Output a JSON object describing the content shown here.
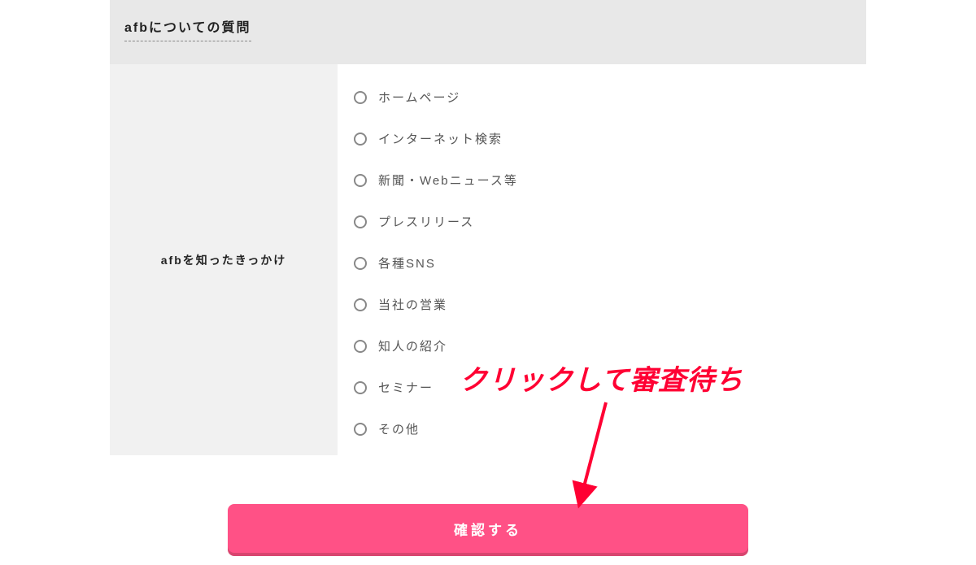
{
  "section": {
    "title": "afbについての質問"
  },
  "question": {
    "label": "afbを知ったきっかけ",
    "options": [
      "ホームページ",
      "インターネット検索",
      "新聞・Webニュース等",
      "プレスリリース",
      "各種SNS",
      "当社の営業",
      "知人の紹介",
      "セミナー",
      "その他"
    ]
  },
  "button": {
    "confirm": "確認する"
  },
  "annotation": {
    "text": "クリックして審査待ち"
  }
}
